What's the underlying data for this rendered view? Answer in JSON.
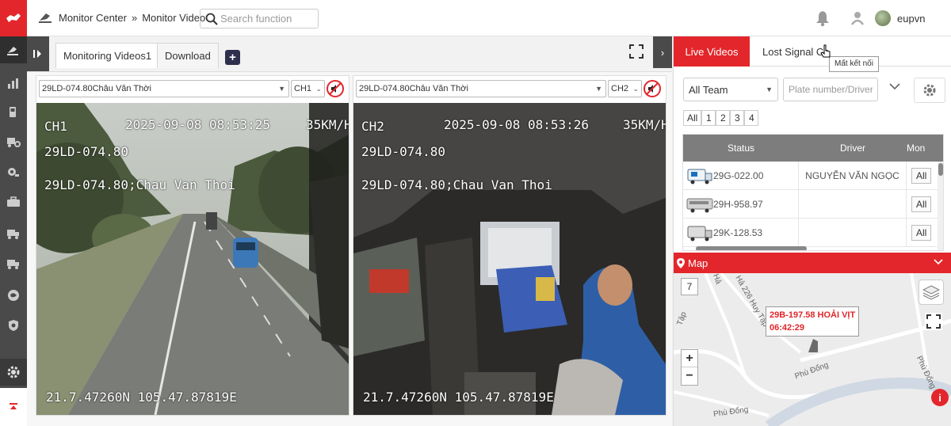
{
  "colors": {
    "brand": "#e3262b",
    "sidebar": "#4a4a4a"
  },
  "header": {
    "breadcrumb_root": "Monitor Center",
    "breadcrumb_sep": "»",
    "breadcrumb_page": "Monitor Video",
    "search_placeholder": "Search function",
    "username": "eupvn"
  },
  "sidebar": {
    "items": [
      "dashboard-icon",
      "chart-icon",
      "fuel-icon",
      "truck-settings-icon",
      "camera-icon",
      "briefcase-icon",
      "truck-icon",
      "truck-icon-2",
      "globe-icon",
      "shield-icon"
    ],
    "settings_icon": "gear-icon",
    "bottom_icon": "arrow-up-icon"
  },
  "tabs": {
    "items": [
      {
        "label": "Monitoring Videos1",
        "active": true
      },
      {
        "label": "Download",
        "active": false
      }
    ],
    "add_label": "+"
  },
  "videos": [
    {
      "plate_option": "29LD-074.80Châu Văn Thời",
      "channel": "CH1",
      "osd": {
        "channel": "CH1",
        "datetime": "2025-09-08 08:53:25",
        "speed": "35KM/H",
        "plate": "29LD-074.80",
        "plate_driver": "29LD-074.80;Chau Van Thoi",
        "coords": "21.7.47260N 105.47.87819E"
      }
    },
    {
      "plate_option": "29LD-074.80Châu Văn Thời",
      "channel": "CH2",
      "osd": {
        "channel": "CH2",
        "datetime": "2025-09-08 08:53:26",
        "speed": "35KM/H",
        "plate": "29LD-074.80",
        "plate_driver": "29LD-074.80;Chau Van Thoi",
        "coords": "21.7.47260N 105.47.87819E"
      }
    }
  ],
  "right_panel": {
    "tab_live": "Live Videos",
    "tab_lost": "Lost Signal Ca",
    "tooltip": "Mất kết nối",
    "team_select": "All Team",
    "plate_placeholder": "Plate number/Driver",
    "pages": [
      "All",
      "1",
      "2",
      "3",
      "4"
    ],
    "table": {
      "headers": {
        "status": "Status",
        "driver": "Driver",
        "mon": "Mon"
      },
      "rows": [
        {
          "plate": "29G-022.00",
          "driver": "NGUYỄN VĂN NGỌC",
          "action": "All"
        },
        {
          "plate": "29H-958.97",
          "driver": "",
          "action": "All"
        },
        {
          "plate": "29K-128.53",
          "driver": "",
          "action": "All"
        }
      ]
    },
    "map": {
      "title": "Map",
      "zoom_level": "7",
      "zoom_in": "+",
      "zoom_out": "−",
      "marker_plate": "29B-197.58 HOẢI VỊT",
      "marker_time": "06:42:29",
      "streets": [
        "Tập",
        "Hả",
        "Hả 226 Huy Tập",
        "Phù Đổng",
        "Phù Đổng",
        "Phù Đổng"
      ],
      "info": "i"
    }
  }
}
